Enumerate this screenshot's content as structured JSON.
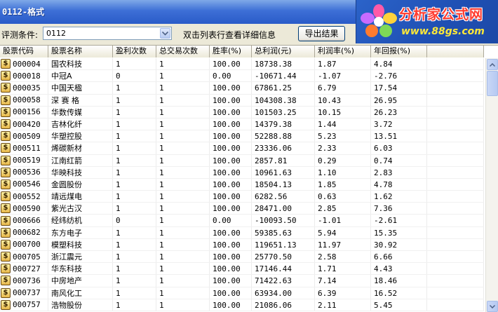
{
  "window": {
    "title": "0112-格式"
  },
  "logo": {
    "name": "分析家公式网",
    "url": "www.88gs.com"
  },
  "toolbar": {
    "condition_label": "评测条件:",
    "condition_value": "0112",
    "hint": "双击列表行查看详细信息",
    "export_label": "导出结果"
  },
  "table": {
    "columns": [
      "股票代码",
      "股票名称",
      "盈利次数",
      "总交易次数",
      "胜率(%)",
      "总利润(元)",
      "利润率(%)",
      "年回报(%)",
      ""
    ],
    "rows": [
      {
        "code": "000004",
        "name": "国农科技",
        "wins": "1",
        "trades": "1",
        "winrate": "100.00",
        "profit": "18738.38",
        "margin": "1.87",
        "annual": "4.84"
      },
      {
        "code": "000018",
        "name": "中冠A",
        "wins": "0",
        "trades": "1",
        "winrate": "0.00",
        "profit": "-10671.44",
        "margin": "-1.07",
        "annual": "-2.76"
      },
      {
        "code": "000035",
        "name": "中国天楹",
        "wins": "1",
        "trades": "1",
        "winrate": "100.00",
        "profit": "67861.25",
        "margin": "6.79",
        "annual": "17.54"
      },
      {
        "code": "000058",
        "name": "深 赛 格",
        "wins": "1",
        "trades": "1",
        "winrate": "100.00",
        "profit": "104308.38",
        "margin": "10.43",
        "annual": "26.95"
      },
      {
        "code": "000156",
        "name": "华数传媒",
        "wins": "1",
        "trades": "1",
        "winrate": "100.00",
        "profit": "101503.25",
        "margin": "10.15",
        "annual": "26.23"
      },
      {
        "code": "000420",
        "name": "吉林化纤",
        "wins": "1",
        "trades": "1",
        "winrate": "100.00",
        "profit": "14379.38",
        "margin": "1.44",
        "annual": "3.72"
      },
      {
        "code": "000509",
        "name": "华塑控股",
        "wins": "1",
        "trades": "1",
        "winrate": "100.00",
        "profit": "52288.88",
        "margin": "5.23",
        "annual": "13.51"
      },
      {
        "code": "000511",
        "name": "烯碳新材",
        "wins": "1",
        "trades": "1",
        "winrate": "100.00",
        "profit": "23336.06",
        "margin": "2.33",
        "annual": "6.03"
      },
      {
        "code": "000519",
        "name": "江南红箭",
        "wins": "1",
        "trades": "1",
        "winrate": "100.00",
        "profit": "2857.81",
        "margin": "0.29",
        "annual": "0.74"
      },
      {
        "code": "000536",
        "name": "华映科技",
        "wins": "1",
        "trades": "1",
        "winrate": "100.00",
        "profit": "10961.63",
        "margin": "1.10",
        "annual": "2.83"
      },
      {
        "code": "000546",
        "name": "金圆股份",
        "wins": "1",
        "trades": "1",
        "winrate": "100.00",
        "profit": "18504.13",
        "margin": "1.85",
        "annual": "4.78"
      },
      {
        "code": "000552",
        "name": "靖远煤电",
        "wins": "1",
        "trades": "1",
        "winrate": "100.00",
        "profit": "6282.56",
        "margin": "0.63",
        "annual": "1.62"
      },
      {
        "code": "000590",
        "name": "紫光古汉",
        "wins": "1",
        "trades": "1",
        "winrate": "100.00",
        "profit": "28471.00",
        "margin": "2.85",
        "annual": "7.36"
      },
      {
        "code": "000666",
        "name": "经纬纺机",
        "wins": "0",
        "trades": "1",
        "winrate": "0.00",
        "profit": "-10093.50",
        "margin": "-1.01",
        "annual": "-2.61"
      },
      {
        "code": "000682",
        "name": "东方电子",
        "wins": "1",
        "trades": "1",
        "winrate": "100.00",
        "profit": "59385.63",
        "margin": "5.94",
        "annual": "15.35"
      },
      {
        "code": "000700",
        "name": "模塑科技",
        "wins": "1",
        "trades": "1",
        "winrate": "100.00",
        "profit": "119651.13",
        "margin": "11.97",
        "annual": "30.92"
      },
      {
        "code": "000705",
        "name": "浙江震元",
        "wins": "1",
        "trades": "1",
        "winrate": "100.00",
        "profit": "25770.50",
        "margin": "2.58",
        "annual": "6.66"
      },
      {
        "code": "000727",
        "name": "华东科技",
        "wins": "1",
        "trades": "1",
        "winrate": "100.00",
        "profit": "17146.44",
        "margin": "1.71",
        "annual": "4.43"
      },
      {
        "code": "000736",
        "name": "中房地产",
        "wins": "1",
        "trades": "1",
        "winrate": "100.00",
        "profit": "71422.63",
        "margin": "7.14",
        "annual": "18.46"
      },
      {
        "code": "000737",
        "name": "南风化工",
        "wins": "1",
        "trades": "1",
        "winrate": "100.00",
        "profit": "63934.00",
        "margin": "6.39",
        "annual": "16.52"
      },
      {
        "code": "000757",
        "name": "浩物股份",
        "wins": "1",
        "trades": "1",
        "winrate": "100.00",
        "profit": "21086.06",
        "margin": "2.11",
        "annual": "5.45"
      }
    ]
  },
  "colors": {
    "titlebar": "#3d6fd6",
    "logo_text": "#ff3b2f",
    "logo_url": "#ffe838"
  },
  "icons": {
    "stock": "dollar-coin-icon",
    "dropdown": "chevron-down-icon"
  }
}
